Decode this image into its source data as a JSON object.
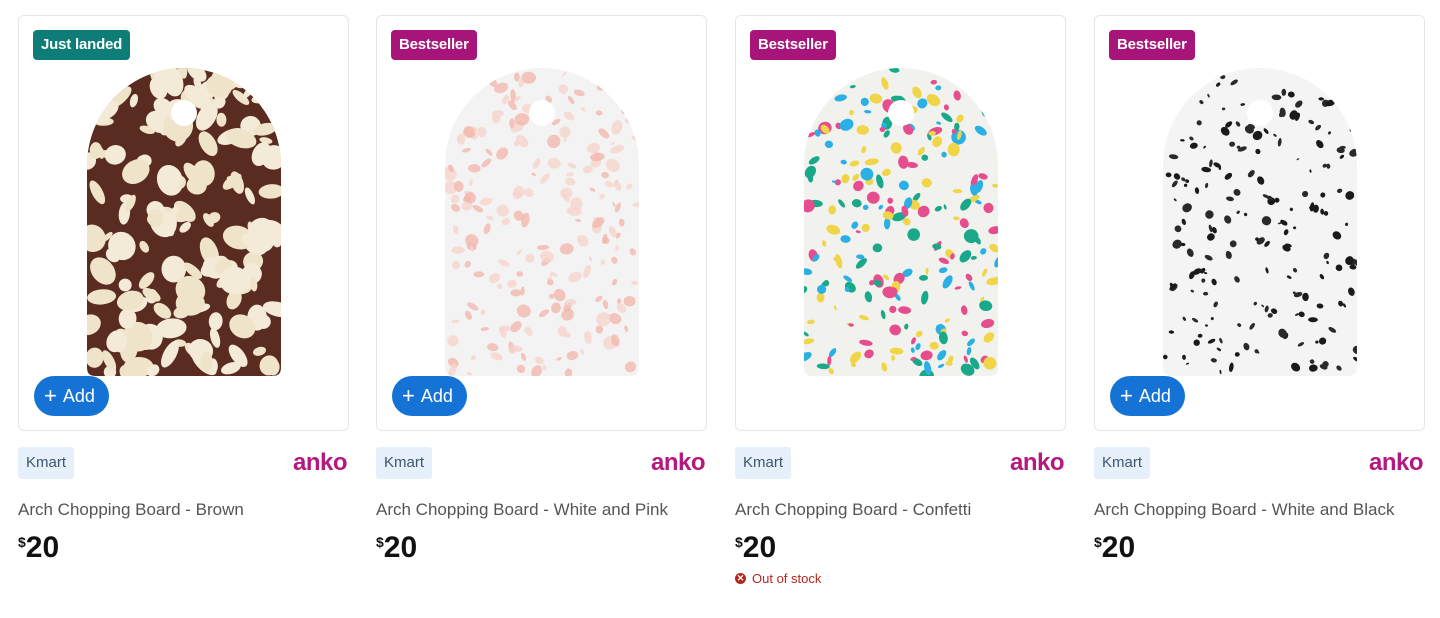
{
  "products": [
    {
      "badge": "Just landed",
      "badge_color": "#0f7d77",
      "add_label": "Add",
      "brand_tag": "Kmart",
      "brand_logo": "anko",
      "name": "Arch Chopping Board - Brown",
      "currency": "$",
      "price": "20",
      "stock": "",
      "board": {
        "base": "#5a2b21",
        "flecks": [
          "#efe3c9",
          "#f4ead8"
        ]
      }
    },
    {
      "badge": "Bestseller",
      "badge_color": "#a8157a",
      "add_label": "Add",
      "brand_tag": "Kmart",
      "brand_logo": "anko",
      "name": "Arch Chopping Board - White and Pink",
      "currency": "$",
      "price": "20",
      "stock": "",
      "board": {
        "base": "#f3f3f3",
        "flecks": [
          "#f2b4a8",
          "#f7d3cb"
        ]
      }
    },
    {
      "badge": "Bestseller",
      "badge_color": "#a8157a",
      "add_label": "",
      "brand_tag": "Kmart",
      "brand_logo": "anko",
      "name": "Arch Chopping Board - Confetti",
      "currency": "$",
      "price": "20",
      "stock": "Out of stock",
      "board": {
        "base": "#f1f1ee",
        "flecks": [
          "#1aa88a",
          "#2ab0e4",
          "#e64d8d",
          "#f0d548"
        ]
      }
    },
    {
      "badge": "Bestseller",
      "badge_color": "#a8157a",
      "add_label": "Add",
      "brand_tag": "Kmart",
      "brand_logo": "anko",
      "name": "Arch Chopping Board - White and Black",
      "currency": "$",
      "price": "20",
      "stock": "",
      "board": {
        "base": "#f4f4f4",
        "flecks": [
          "#1a1a1a",
          "#2a2a2a"
        ]
      }
    }
  ]
}
